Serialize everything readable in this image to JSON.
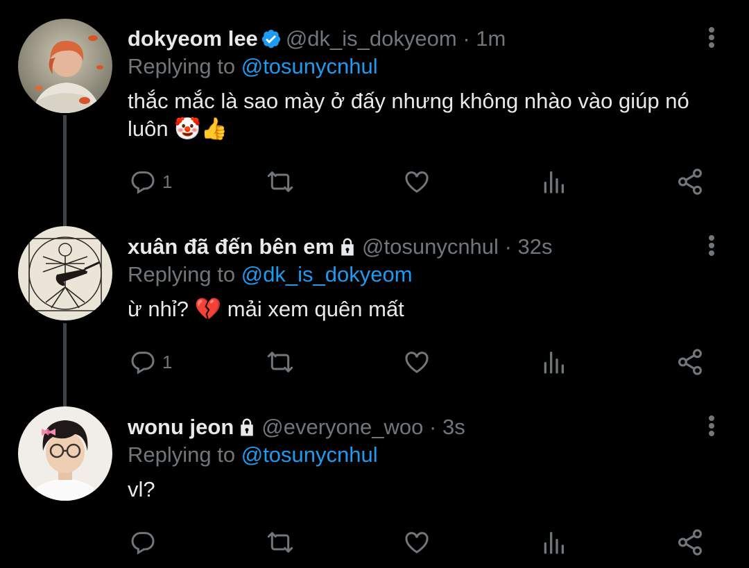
{
  "tweets": [
    {
      "name": "dokyeom lee",
      "verified": true,
      "locked": false,
      "handle": "@dk_is_dokyeom",
      "dot": "·",
      "time": "1m",
      "replying_prefix": "Replying to",
      "replying_to": "@tosunycnhul",
      "text": "thắc mắc là sao mày ở đấy nhưng không nhào vào giúp nó luôn 🤡👍",
      "reply_count": "1"
    },
    {
      "name": "xuân đã đến bên em",
      "verified": false,
      "locked": true,
      "handle": "@tosunycnhul",
      "dot": "·",
      "time": "32s",
      "replying_prefix": "Replying to",
      "replying_to": "@dk_is_dokyeom",
      "text": "ừ nhỉ? 💔 mải xem quên mất",
      "reply_count": "1"
    },
    {
      "name": "wonu jeon",
      "verified": false,
      "locked": true,
      "handle": "@everyone_woo",
      "dot": "·",
      "time": "3s",
      "replying_prefix": "Replying to",
      "replying_to": "@tosunycnhul",
      "text": "vl?",
      "reply_count": ""
    }
  ],
  "icons": {
    "reply": "reply-icon",
    "retweet": "retweet-icon",
    "like": "heart-icon",
    "analytics": "analytics-icon",
    "share": "share-icon",
    "more": "more-vertical-icon",
    "verified": "verified-badge-icon",
    "lock": "lock-icon"
  },
  "colors": {
    "background": "#000000",
    "text": "#e7e9ea",
    "muted": "#71767b",
    "accent": "#1d9bf0"
  }
}
